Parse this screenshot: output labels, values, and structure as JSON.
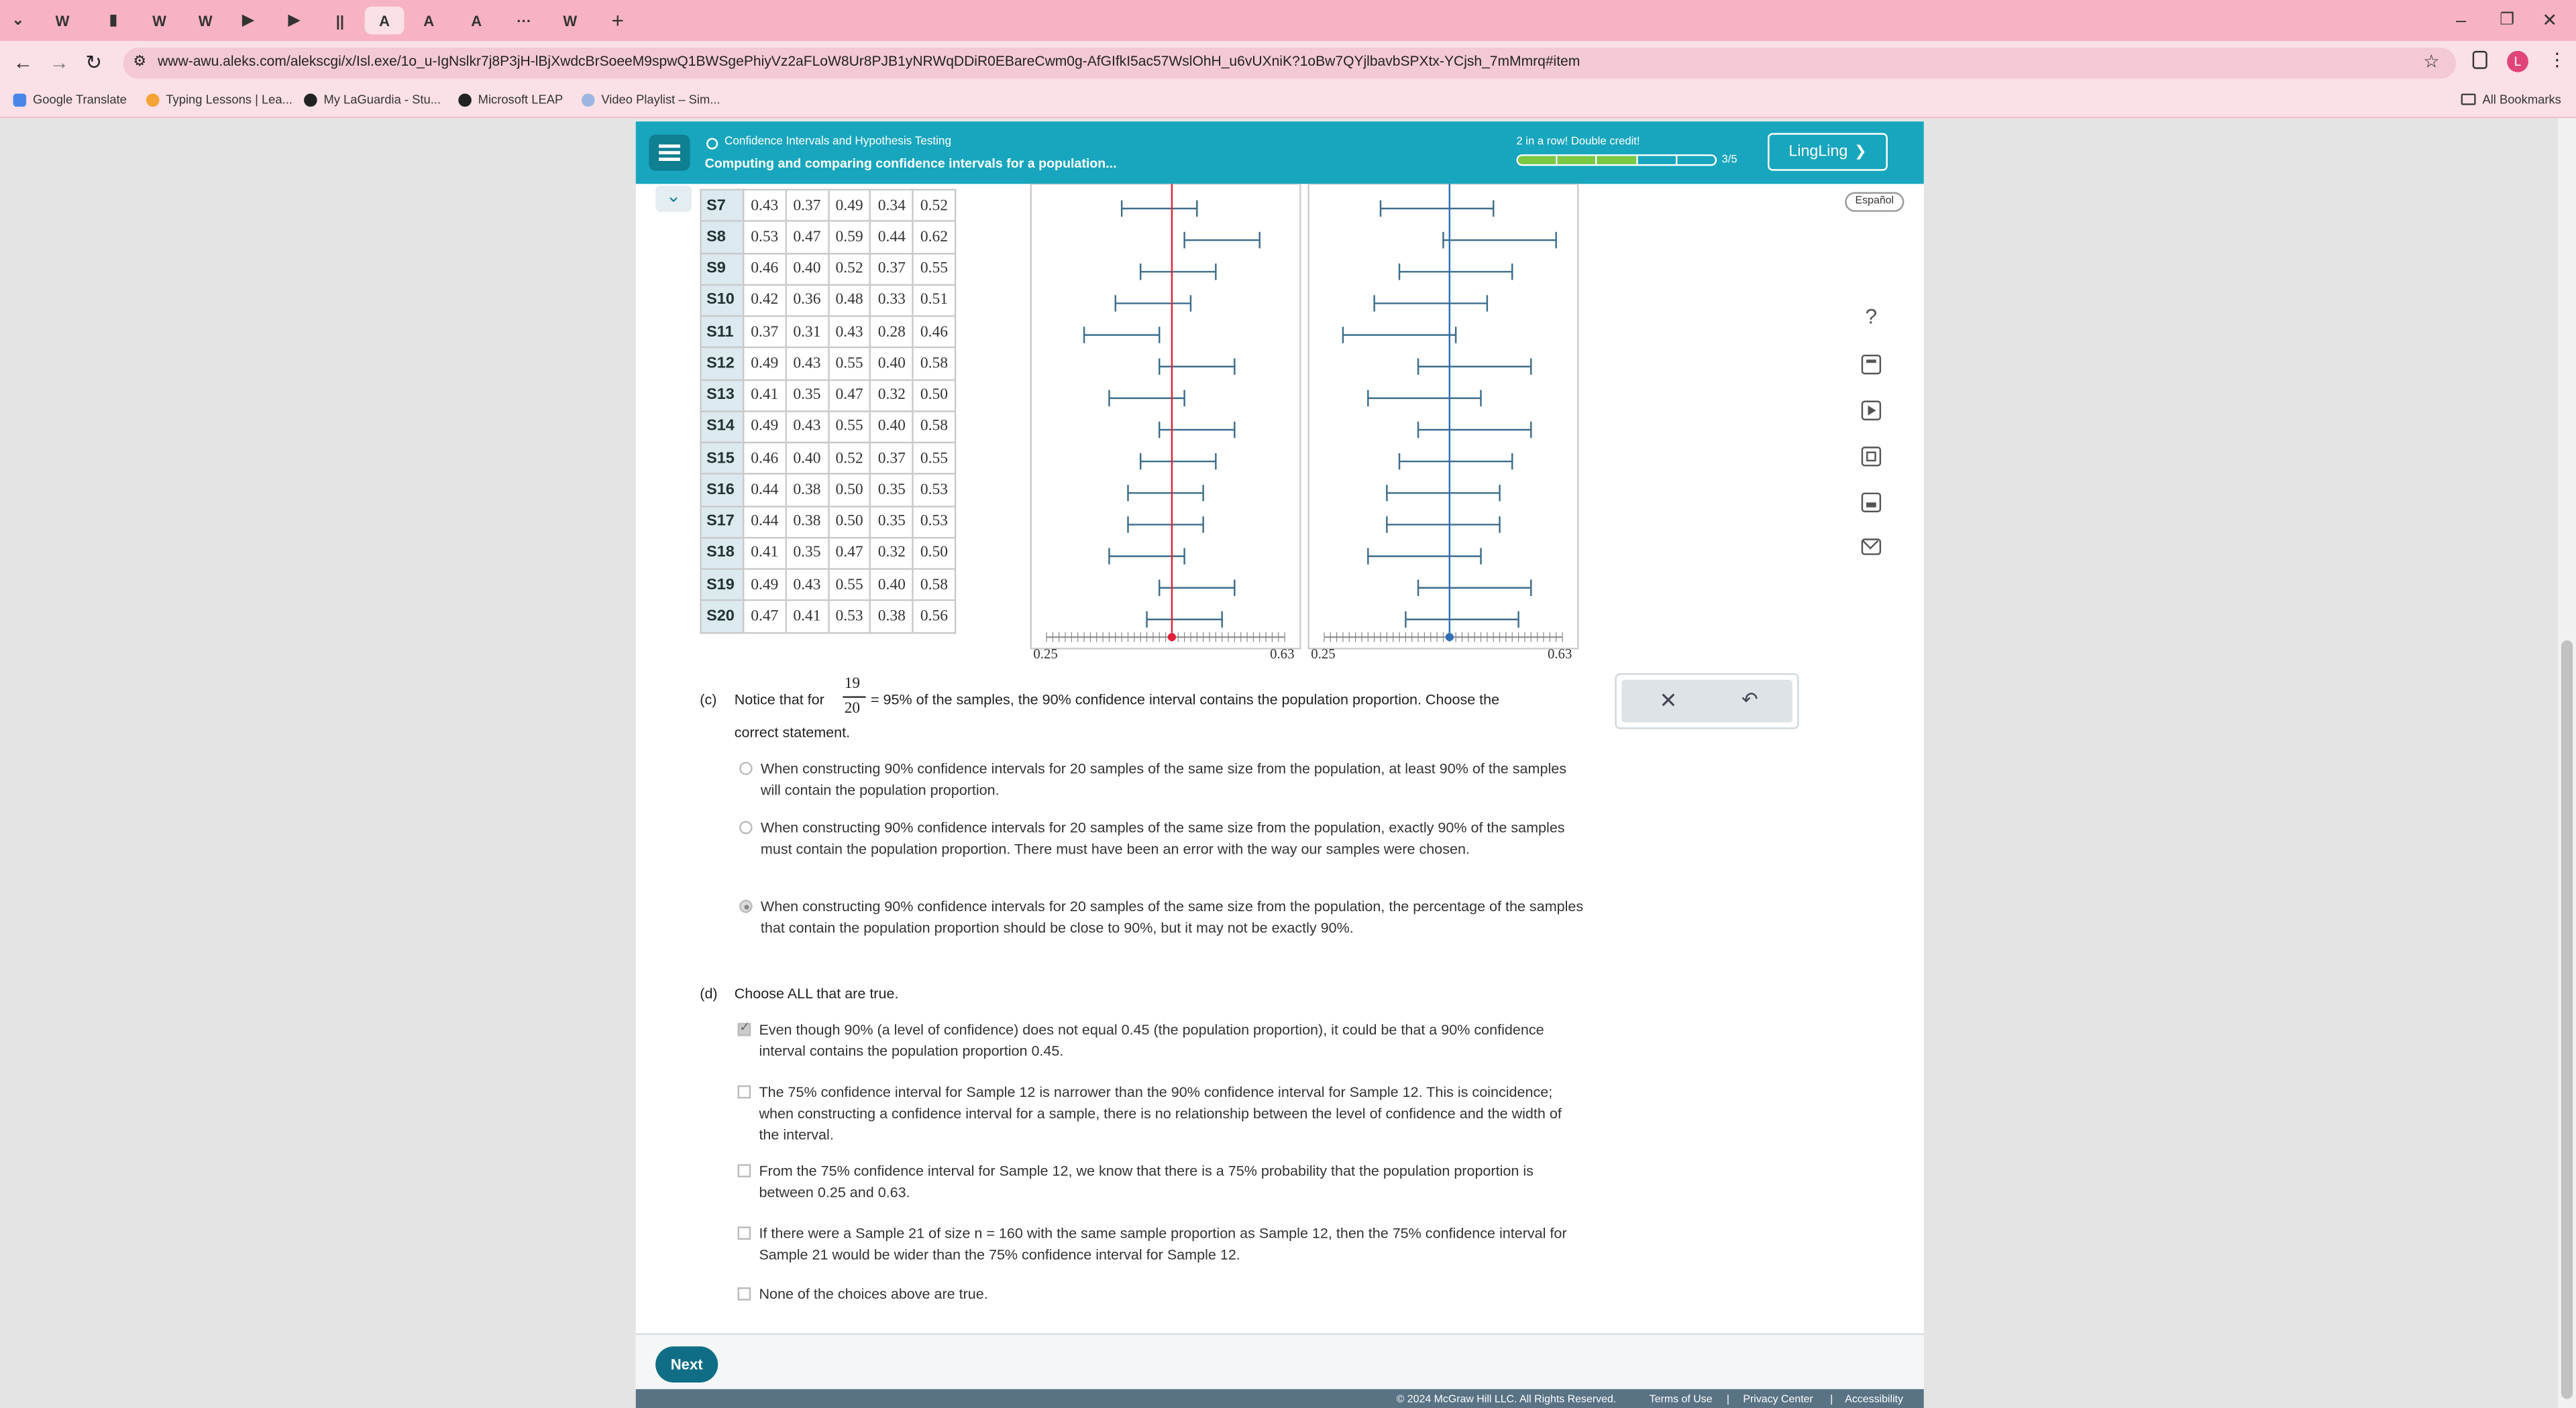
{
  "browser": {
    "tabs": [
      "W",
      "▮",
      "W",
      "W",
      "▶",
      "▶",
      "||",
      "A",
      "A",
      "A",
      "···",
      "W"
    ],
    "url": "www-awu.aleks.com/alekscgi/x/Isl.exe/1o_u-IgNslkr7j8P3jH-lBjXwdcBrSoeeM9spwQ1BWSgePhiyVz2aFLoW8Ur8PJB1yNRWqDDiR0EBareCwm0g-AfGIfkI5ac57WslOhH_u6vUXniK?1oBw7QYjlbavbSPXtx-YCjsh_7mMmrq#item",
    "avatar": "L",
    "bookmarks": [
      "Google Translate",
      "Typing Lessons | Lea...",
      "My LaGuardia - Stu...",
      "Microsoft LEAP",
      "Video Playlist – Sim..."
    ],
    "all_bookmarks": "All Bookmarks"
  },
  "header": {
    "topic": "Confidence Intervals and Hypothesis Testing",
    "subtitle": "Computing and comparing confidence intervals for a population...",
    "streak": "2 in a row! Double credit!",
    "progress_text": "3/5",
    "progress_filled": 3,
    "progress_total": 5,
    "user": "LingLing",
    "language": "Español"
  },
  "table": {
    "rows": [
      {
        "label": "S7",
        "v": [
          "0.43",
          "0.37",
          "0.49",
          "0.34",
          "0.52"
        ]
      },
      {
        "label": "S8",
        "v": [
          "0.53",
          "0.47",
          "0.59",
          "0.44",
          "0.62"
        ]
      },
      {
        "label": "S9",
        "v": [
          "0.46",
          "0.40",
          "0.52",
          "0.37",
          "0.55"
        ]
      },
      {
        "label": "S10",
        "v": [
          "0.42",
          "0.36",
          "0.48",
          "0.33",
          "0.51"
        ]
      },
      {
        "label": "S11",
        "v": [
          "0.37",
          "0.31",
          "0.43",
          "0.28",
          "0.46"
        ]
      },
      {
        "label": "S12",
        "v": [
          "0.49",
          "0.43",
          "0.55",
          "0.40",
          "0.58"
        ]
      },
      {
        "label": "S13",
        "v": [
          "0.41",
          "0.35",
          "0.47",
          "0.32",
          "0.50"
        ]
      },
      {
        "label": "S14",
        "v": [
          "0.49",
          "0.43",
          "0.55",
          "0.40",
          "0.58"
        ]
      },
      {
        "label": "S15",
        "v": [
          "0.46",
          "0.40",
          "0.52",
          "0.37",
          "0.55"
        ]
      },
      {
        "label": "S16",
        "v": [
          "0.44",
          "0.38",
          "0.50",
          "0.35",
          "0.53"
        ]
      },
      {
        "label": "S17",
        "v": [
          "0.44",
          "0.38",
          "0.50",
          "0.35",
          "0.53"
        ]
      },
      {
        "label": "S18",
        "v": [
          "0.41",
          "0.35",
          "0.47",
          "0.32",
          "0.50"
        ]
      },
      {
        "label": "S19",
        "v": [
          "0.49",
          "0.43",
          "0.55",
          "0.40",
          "0.58"
        ]
      },
      {
        "label": "S20",
        "v": [
          "0.47",
          "0.41",
          "0.53",
          "0.38",
          "0.56"
        ]
      }
    ]
  },
  "chart_data": [
    {
      "type": "interval",
      "xlim": [
        0.25,
        0.63
      ],
      "axis_labels": [
        "0.25",
        "0.63"
      ],
      "reference": 0.45,
      "reference_color": "#e0223a",
      "intervals": [
        [
          0.37,
          0.49
        ],
        [
          0.47,
          0.59
        ],
        [
          0.4,
          0.52
        ],
        [
          0.36,
          0.48
        ],
        [
          0.31,
          0.43
        ],
        [
          0.43,
          0.55
        ],
        [
          0.35,
          0.47
        ],
        [
          0.43,
          0.55
        ],
        [
          0.4,
          0.52
        ],
        [
          0.38,
          0.5
        ],
        [
          0.38,
          0.5
        ],
        [
          0.35,
          0.47
        ],
        [
          0.43,
          0.55
        ],
        [
          0.41,
          0.53
        ]
      ]
    },
    {
      "type": "interval",
      "xlim": [
        0.25,
        0.63
      ],
      "axis_labels": [
        "0.25",
        "0.63"
      ],
      "reference": 0.45,
      "reference_color": "#2f6fb5",
      "intervals": [
        [
          0.34,
          0.52
        ],
        [
          0.44,
          0.62
        ],
        [
          0.37,
          0.55
        ],
        [
          0.33,
          0.51
        ],
        [
          0.28,
          0.46
        ],
        [
          0.4,
          0.58
        ],
        [
          0.32,
          0.5
        ],
        [
          0.4,
          0.58
        ],
        [
          0.37,
          0.55
        ],
        [
          0.35,
          0.53
        ],
        [
          0.35,
          0.53
        ],
        [
          0.32,
          0.5
        ],
        [
          0.4,
          0.58
        ],
        [
          0.38,
          0.56
        ]
      ]
    }
  ],
  "part_c": {
    "label": "(c)",
    "frac_num": "19",
    "frac_den": "20",
    "text_a": "Notice that for",
    "text_b": "= 95% of the samples, the 90% confidence interval contains the population proportion. Choose the",
    "text_c": "correct statement.",
    "options": [
      "When constructing 90% confidence intervals for 20 samples of the same size from the population, at least 90% of the samples will contain the population proportion.",
      "When constructing 90% confidence intervals for 20 samples of the same size from the population, exactly 90% of the samples must contain the population proportion. There must have been an error with the way our samples were chosen.",
      "When constructing 90% confidence intervals for 20 samples of the same size from the population, the percentage of the samples that contain the population proportion should be close to 90%, but it may not be exactly 90%."
    ],
    "selected": 2
  },
  "part_d": {
    "label": "(d)",
    "prompt": "Choose ALL that are true.",
    "options": [
      "Even though 90% (a level of confidence) does not equal 0.45 (the population proportion), it could be that a 90% confidence interval contains the population proportion 0.45.",
      "The 75% confidence interval for Sample 12 is narrower than the 90% confidence interval for Sample 12. This is coincidence; when constructing a confidence interval for a sample, there is no relationship between the level of confidence and the width of the interval.",
      "From the 75% confidence interval for Sample 12, we know that there is a 75% probability that the population proportion is between 0.25 and 0.63.",
      "If there were a Sample 21 of size n = 160 with the same sample proportion as Sample 12, then the 75% confidence interval for Sample 21 would be wider than the 75% confidence interval for Sample 12.",
      "None of the choices above are true."
    ],
    "checked": [
      true,
      false,
      false,
      false,
      false
    ]
  },
  "next_button": "Next",
  "footer": {
    "copyright": "© 2024 McGraw Hill LLC. All Rights Reserved.",
    "terms": "Terms of Use",
    "privacy": "Privacy Center",
    "accessibility": "Accessibility"
  }
}
